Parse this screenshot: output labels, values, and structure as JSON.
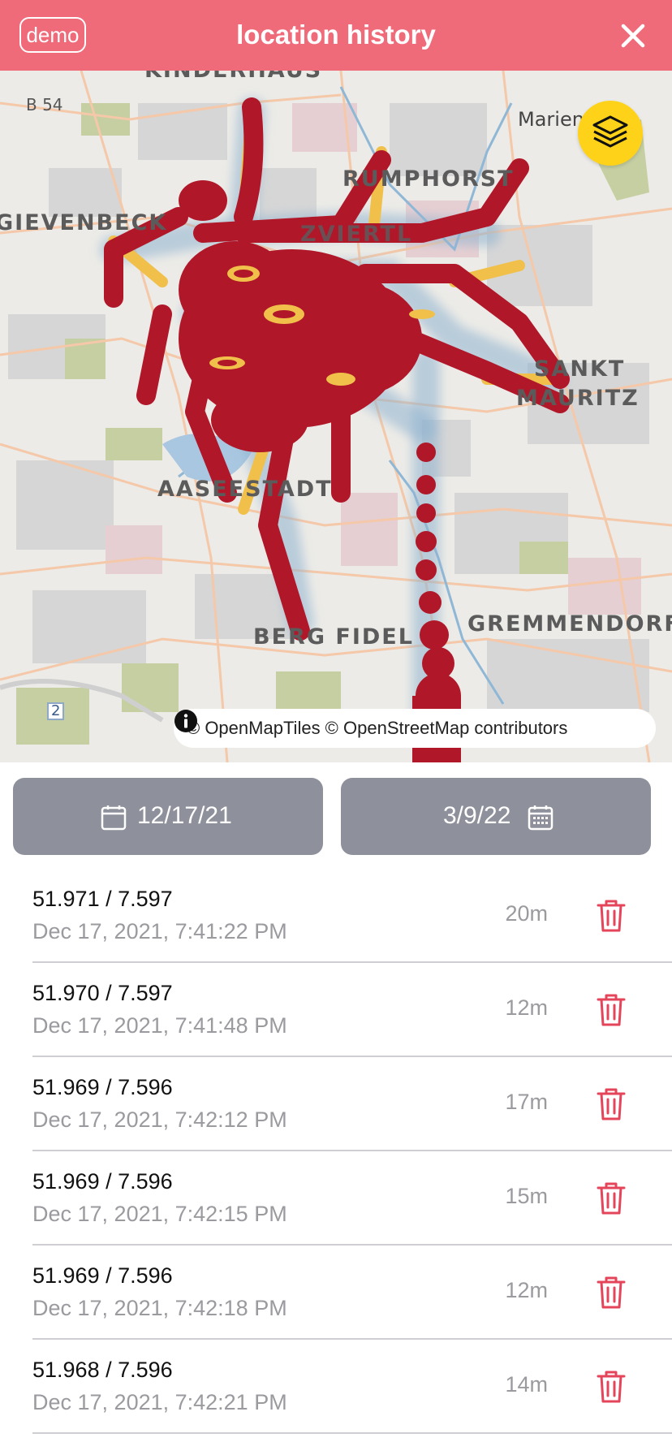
{
  "header": {
    "demo_label": "demo",
    "title": "location history",
    "close_icon": "close-icon",
    "color": "#f06b7a"
  },
  "map": {
    "labels": {
      "kinderhaus": "KINDERHAUS",
      "b54": "B 54",
      "marien": "Marien",
      "rumphorst": "RUMPHORST",
      "gievenbeck": "GIEVENBECK",
      "kreuzviertel": "ZVIERTL",
      "sankt": "SANKT",
      "mauritz": "MAURITZ",
      "aaseestadt": "AASEESTADT",
      "bergfidel": "BERG FIDEL",
      "gremmendorf": "GREMMENDORF",
      "road2": "2"
    },
    "layers_icon": "layers-icon",
    "attribution": "© OpenMapTiles © OpenStreetMap contributors",
    "info_icon": "info-icon",
    "heatmap_color": "#b0182a",
    "layers_button_color": "#ffd21a"
  },
  "date_range": {
    "start": "12/17/21",
    "end": "3/9/22",
    "button_color": "#8e919b"
  },
  "entries": [
    {
      "coords": "51.971 / 7.597",
      "time": "Dec 17, 2021, 7:41:22 PM",
      "accuracy": "20m"
    },
    {
      "coords": "51.970 / 7.597",
      "time": "Dec 17, 2021, 7:41:48 PM",
      "accuracy": "12m"
    },
    {
      "coords": "51.969 / 7.596",
      "time": "Dec 17, 2021, 7:42:12 PM",
      "accuracy": "17m"
    },
    {
      "coords": "51.969 / 7.596",
      "time": "Dec 17, 2021, 7:42:15 PM",
      "accuracy": "15m"
    },
    {
      "coords": "51.969 / 7.596",
      "time": "Dec 17, 2021, 7:42:18 PM",
      "accuracy": "12m"
    },
    {
      "coords": "51.968 / 7.596",
      "time": "Dec 17, 2021, 7:42:21 PM",
      "accuracy": "14m"
    }
  ],
  "icons": {
    "trash": "trash-icon",
    "calendar": "calendar-icon",
    "trash_color": "#e5455a"
  }
}
